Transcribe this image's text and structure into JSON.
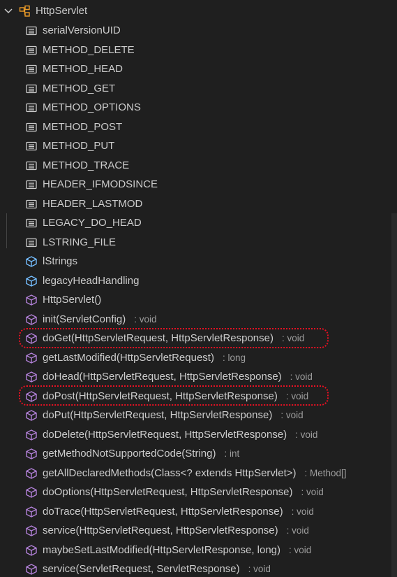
{
  "root": {
    "label": "HttpServlet",
    "icon": "class-icon",
    "expanded": true
  },
  "members": [
    {
      "name": "serialVersionUID",
      "type": "",
      "kind": "field"
    },
    {
      "name": "METHOD_DELETE",
      "type": "",
      "kind": "field"
    },
    {
      "name": "METHOD_HEAD",
      "type": "",
      "kind": "field"
    },
    {
      "name": "METHOD_GET",
      "type": "",
      "kind": "field"
    },
    {
      "name": "METHOD_OPTIONS",
      "type": "",
      "kind": "field"
    },
    {
      "name": "METHOD_POST",
      "type": "",
      "kind": "field"
    },
    {
      "name": "METHOD_PUT",
      "type": "",
      "kind": "field"
    },
    {
      "name": "METHOD_TRACE",
      "type": "",
      "kind": "field"
    },
    {
      "name": "HEADER_IFMODSINCE",
      "type": "",
      "kind": "field"
    },
    {
      "name": "HEADER_LASTMOD",
      "type": "",
      "kind": "field"
    },
    {
      "name": "LEGACY_DO_HEAD",
      "type": "",
      "kind": "field"
    },
    {
      "name": "LSTRING_FILE",
      "type": "",
      "kind": "field"
    },
    {
      "name": "lStrings",
      "type": "",
      "kind": "variable"
    },
    {
      "name": "legacyHeadHandling",
      "type": "",
      "kind": "variable"
    },
    {
      "name": "HttpServlet()",
      "type": "",
      "kind": "method"
    },
    {
      "name": "init(ServletConfig)",
      "type": ": void",
      "kind": "method"
    },
    {
      "name": "doGet(HttpServletRequest, HttpServletResponse)",
      "type": ": void",
      "kind": "method",
      "highlighted": true
    },
    {
      "name": "getLastModified(HttpServletRequest)",
      "type": ": long",
      "kind": "method"
    },
    {
      "name": "doHead(HttpServletRequest, HttpServletResponse)",
      "type": ": void",
      "kind": "method"
    },
    {
      "name": "doPost(HttpServletRequest, HttpServletResponse)",
      "type": ": void",
      "kind": "method",
      "highlighted": true
    },
    {
      "name": "doPut(HttpServletRequest, HttpServletResponse)",
      "type": ": void",
      "kind": "method"
    },
    {
      "name": "doDelete(HttpServletRequest, HttpServletResponse)",
      "type": ": void",
      "kind": "method"
    },
    {
      "name": "getMethodNotSupportedCode(String)",
      "type": ": int",
      "kind": "method"
    },
    {
      "name": "getAllDeclaredMethods(Class<? extends HttpServlet>)",
      "type": ": Method[]",
      "kind": "method"
    },
    {
      "name": "doOptions(HttpServletRequest, HttpServletResponse)",
      "type": ": void",
      "kind": "method"
    },
    {
      "name": "doTrace(HttpServletRequest, HttpServletResponse)",
      "type": ": void",
      "kind": "method"
    },
    {
      "name": "service(HttpServletRequest, HttpServletResponse)",
      "type": ": void",
      "kind": "method"
    },
    {
      "name": "maybeSetLastModified(HttpServletResponse, long)",
      "type": ": void",
      "kind": "method"
    },
    {
      "name": "service(ServletRequest, ServletResponse)",
      "type": ": void",
      "kind": "method"
    }
  ],
  "colors": {
    "background": "#1f1f1f",
    "text": "#cccccc",
    "type_text": "#9d9d9d",
    "field_icon": "#cccccc",
    "variable_icon": "#75beff",
    "method_icon": "#b180d7",
    "class_icon": "#ee9d28",
    "highlight_border": "#e81123"
  }
}
